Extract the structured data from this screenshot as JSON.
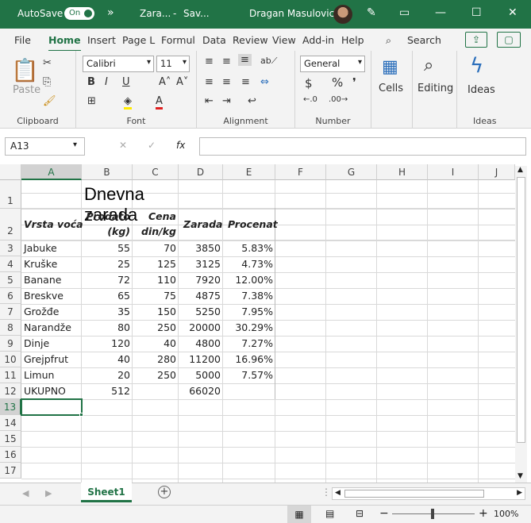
{
  "titlebar": {
    "autosave": "AutoSave",
    "toggle": "On",
    "more": "»",
    "doc_title": "Zara...",
    "sep": "-",
    "save_state": "Sav...",
    "user": "Dragan Masulovic"
  },
  "tabs": [
    "File",
    "Home",
    "Insert",
    "Page L",
    "Formul",
    "Data",
    "Review",
    "View",
    "Add-in",
    "Help"
  ],
  "search": "Search",
  "ribbon": {
    "paste": "Paste",
    "clipboard": "Clipboard",
    "font_name": "Calibri",
    "font_size": "11",
    "font": "Font",
    "alignment": "Alignment",
    "number_format": "General",
    "number": "Number",
    "cells": "Cells",
    "editing": "Editing",
    "ideas_btn": "Ideas",
    "ideas": "Ideas"
  },
  "formula_bar": {
    "namebox": "A13",
    "fx": "fx",
    "value": ""
  },
  "columns": [
    "A",
    "B",
    "C",
    "D",
    "E",
    "F",
    "G",
    "H",
    "I",
    "J"
  ],
  "rows": [
    "1",
    "2",
    "3",
    "4",
    "5",
    "6",
    "7",
    "8",
    "9",
    "10",
    "11",
    "12",
    "13",
    "14",
    "15",
    "16",
    "17"
  ],
  "sheet": {
    "title": "Dnevna zarada",
    "headers": {
      "a": "Vrsta voća",
      "b1": "Prodato",
      "b2": "(kg)",
      "c1": "Cena",
      "c2": "din/kg",
      "d": "Zarada",
      "e": "Procenat"
    },
    "data": [
      {
        "name": "Jabuke",
        "kg": "55",
        "cena": "70",
        "zarada": "3850",
        "pct": "5.83%"
      },
      {
        "name": "Kruške",
        "kg": "25",
        "cena": "125",
        "zarada": "3125",
        "pct": "4.73%"
      },
      {
        "name": "Banane",
        "kg": "72",
        "cena": "110",
        "zarada": "7920",
        "pct": "12.00%"
      },
      {
        "name": "Breskve",
        "kg": "65",
        "cena": "75",
        "zarada": "4875",
        "pct": "7.38%"
      },
      {
        "name": "Grožđe",
        "kg": "35",
        "cena": "150",
        "zarada": "5250",
        "pct": "7.95%"
      },
      {
        "name": "Narandže",
        "kg": "80",
        "cena": "250",
        "zarada": "20000",
        "pct": "30.29%"
      },
      {
        "name": "Dinje",
        "kg": "120",
        "cena": "40",
        "zarada": "4800",
        "pct": "7.27%"
      },
      {
        "name": "Grejpfrut",
        "kg": "40",
        "cena": "280",
        "zarada": "11200",
        "pct": "16.96%"
      },
      {
        "name": "Limun",
        "kg": "20",
        "cena": "250",
        "zarada": "5000",
        "pct": "7.57%"
      }
    ],
    "total": {
      "name": "UKUPNO",
      "kg": "512",
      "zarada": "66020"
    }
  },
  "sheet_tab": "Sheet1",
  "zoom": "100%",
  "colors": {
    "accent": "#217346"
  }
}
